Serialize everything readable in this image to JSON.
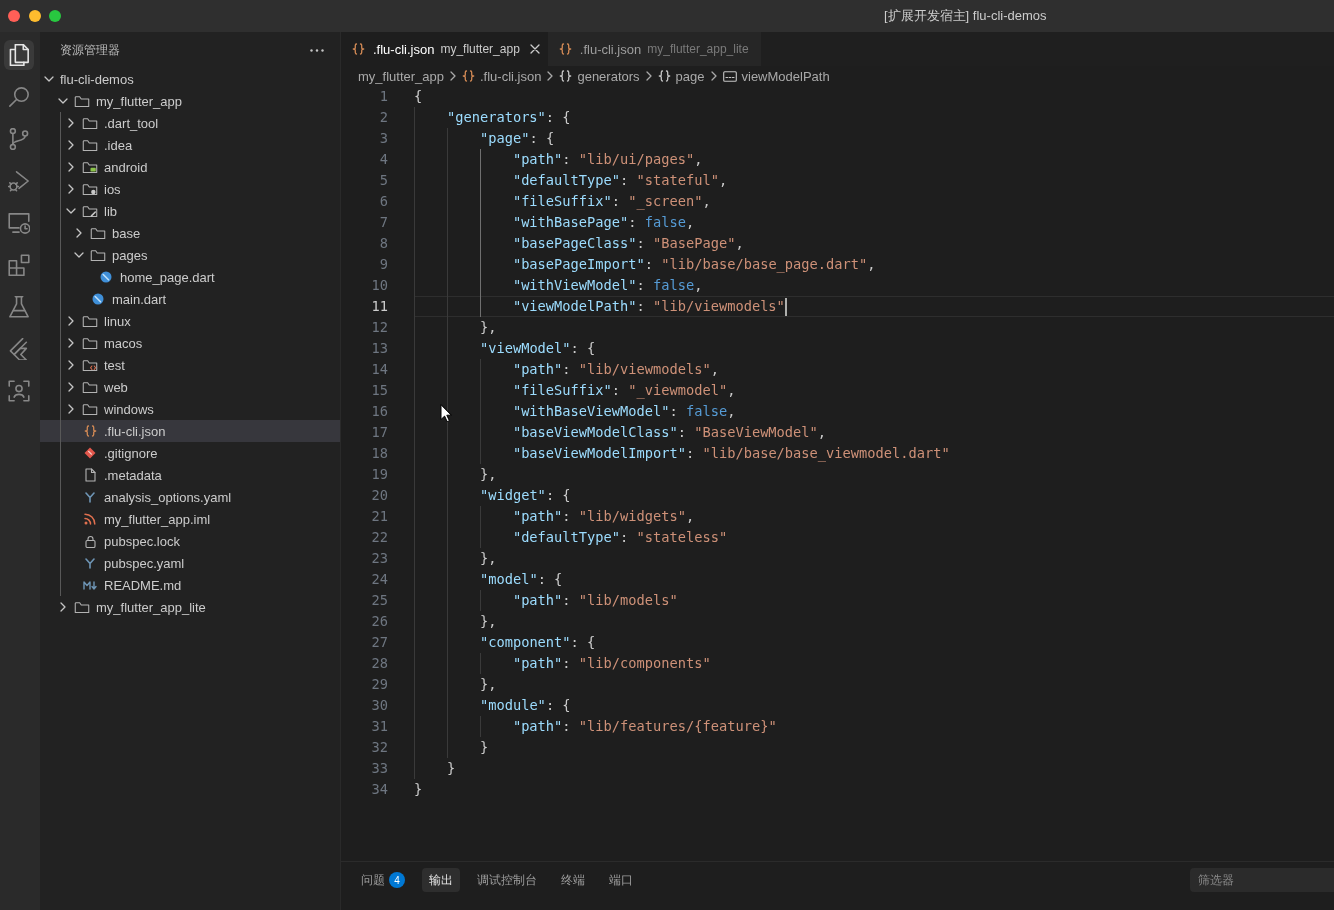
{
  "window": {
    "title": "[扩展开发宿主] flu-cli-demos"
  },
  "activity_bar": {
    "items": [
      {
        "kind": "files",
        "selected": true
      },
      {
        "kind": "search",
        "selected": false
      },
      {
        "kind": "branch",
        "selected": false
      },
      {
        "kind": "debug",
        "selected": false
      },
      {
        "kind": "remote",
        "selected": false
      },
      {
        "kind": "extensions",
        "selected": false
      },
      {
        "kind": "flask",
        "selected": false
      },
      {
        "kind": "chevrons",
        "selected": false
      },
      {
        "kind": "scan",
        "selected": false
      }
    ]
  },
  "explorer": {
    "title": "资源管理器",
    "tree": [
      {
        "label": "flu-cli-demos",
        "kind": "root",
        "expanded": true,
        "selected": false,
        "children": [
          {
            "label": "my_flutter_app",
            "kind": "folder",
            "expanded": true,
            "selected": false,
            "children": [
              {
                "label": ".dart_tool",
                "kind": "folder",
                "expanded": false,
                "selected": false
              },
              {
                "label": ".idea",
                "kind": "folder",
                "expanded": false,
                "selected": false
              },
              {
                "label": "android",
                "kind": "android",
                "expanded": false,
                "selected": false
              },
              {
                "label": "ios",
                "kind": "ios",
                "expanded": false,
                "selected": false
              },
              {
                "label": "lib",
                "kind": "lib",
                "expanded": true,
                "selected": false,
                "children": [
                  {
                    "label": "base",
                    "kind": "folder",
                    "expanded": false,
                    "selected": false
                  },
                  {
                    "label": "pages",
                    "kind": "folder",
                    "expanded": true,
                    "selected": false,
                    "children": [
                      {
                        "label": "home_page.dart",
                        "kind": "dart",
                        "selected": false
                      }
                    ]
                  },
                  {
                    "label": "main.dart",
                    "kind": "dart",
                    "selected": false
                  }
                ]
              },
              {
                "label": "linux",
                "kind": "folder",
                "expanded": false,
                "selected": false
              },
              {
                "label": "macos",
                "kind": "folder",
                "expanded": false,
                "selected": false
              },
              {
                "label": "test",
                "kind": "test",
                "expanded": false,
                "selected": false
              },
              {
                "label": "web",
                "kind": "folder",
                "expanded": false,
                "selected": false
              },
              {
                "label": "windows",
                "kind": "folder",
                "expanded": false,
                "selected": false
              },
              {
                "label": ".flu-cli.json",
                "kind": "json",
                "selected": true
              },
              {
                "label": ".gitignore",
                "kind": "git",
                "selected": false
              },
              {
                "label": ".metadata",
                "kind": "file",
                "selected": false
              },
              {
                "label": "analysis_options.yaml",
                "kind": "yaml",
                "selected": false
              },
              {
                "label": "my_flutter_app.iml",
                "kind": "feed",
                "selected": false
              },
              {
                "label": "pubspec.lock",
                "kind": "lock",
                "selected": false
              },
              {
                "label": "pubspec.yaml",
                "kind": "yaml",
                "selected": false
              },
              {
                "label": "README.md",
                "kind": "markdown",
                "selected": false
              }
            ]
          },
          {
            "label": "my_flutter_app_lite",
            "kind": "folder",
            "expanded": false,
            "selected": false
          }
        ]
      }
    ]
  },
  "editor": {
    "tabs": [
      {
        "filename": ".flu-cli.json",
        "folder": "my_flutter_app",
        "selected": true
      },
      {
        "filename": ".flu-cli.json",
        "folder": "my_flutter_app_lite",
        "selected": false
      }
    ],
    "breadcrumbs": [
      {
        "label": "my_flutter_app",
        "kind": "folder"
      },
      {
        "label": ".flu-cli.json",
        "kind": "json"
      },
      {
        "label": "generators",
        "kind": "object"
      },
      {
        "label": "page",
        "kind": "object"
      },
      {
        "label": "viewModelPath",
        "kind": "string"
      }
    ],
    "lines": [
      {
        "number": "1",
        "text": "{",
        "current": false
      },
      {
        "number": "2",
        "text": "    \"generators\": {",
        "current": false
      },
      {
        "number": "3",
        "text": "        \"page\": {",
        "current": false
      },
      {
        "number": "4",
        "text": "            \"path\": \"lib/ui/pages\",",
        "current": false
      },
      {
        "number": "5",
        "text": "            \"defaultType\": \"stateful\",",
        "current": false
      },
      {
        "number": "6",
        "text": "            \"fileSuffix\": \"_screen\",",
        "current": false
      },
      {
        "number": "7",
        "text": "            \"withBasePage\": false,",
        "current": false
      },
      {
        "number": "8",
        "text": "            \"basePageClass\": \"BasePage\",",
        "current": false
      },
      {
        "number": "9",
        "text": "            \"basePageImport\": \"lib/base/base_page.dart\",",
        "current": false
      },
      {
        "number": "10",
        "text": "            \"withViewModel\": false,",
        "current": false
      },
      {
        "number": "11",
        "text": "            \"viewModelPath\": \"lib/viewmodels\"",
        "current": true
      },
      {
        "number": "12",
        "text": "        },",
        "current": false
      },
      {
        "number": "13",
        "text": "        \"viewModel\": {",
        "current": false
      },
      {
        "number": "14",
        "text": "            \"path\": \"lib/viewmodels\",",
        "current": false
      },
      {
        "number": "15",
        "text": "            \"fileSuffix\": \"_viewmodel\",",
        "current": false
      },
      {
        "number": "16",
        "text": "            \"withBaseViewModel\": false,",
        "current": false
      },
      {
        "number": "17",
        "text": "            \"baseViewModelClass\": \"BaseViewModel\",",
        "current": false
      },
      {
        "number": "18",
        "text": "            \"baseViewModelImport\": \"lib/base/base_viewmodel.dart\"",
        "current": false
      },
      {
        "number": "19",
        "text": "        },",
        "current": false
      },
      {
        "number": "20",
        "text": "        \"widget\": {",
        "current": false
      },
      {
        "number": "21",
        "text": "            \"path\": \"lib/widgets\",",
        "current": false
      },
      {
        "number": "22",
        "text": "            \"defaultType\": \"stateless\"",
        "current": false
      },
      {
        "number": "23",
        "text": "        },",
        "current": false
      },
      {
        "number": "24",
        "text": "        \"model\": {",
        "current": false
      },
      {
        "number": "25",
        "text": "            \"path\": \"lib/models\"",
        "current": false
      },
      {
        "number": "26",
        "text": "        },",
        "current": false
      },
      {
        "number": "27",
        "text": "        \"component\": {",
        "current": false
      },
      {
        "number": "28",
        "text": "            \"path\": \"lib/components\"",
        "current": false
      },
      {
        "number": "29",
        "text": "        },",
        "current": false
      },
      {
        "number": "30",
        "text": "        \"module\": {",
        "current": false
      },
      {
        "number": "31",
        "text": "            \"path\": \"lib/features/{feature}\"",
        "current": false
      },
      {
        "number": "32",
        "text": "        }",
        "current": false
      },
      {
        "number": "33",
        "text": "    }",
        "current": false
      },
      {
        "number": "34",
        "text": "}",
        "current": false
      }
    ]
  },
  "panel": {
    "tabs": [
      {
        "label": "问题",
        "badge": "4",
        "selected": false
      },
      {
        "label": "输出",
        "selected": true
      },
      {
        "label": "调试控制台",
        "selected": false
      },
      {
        "label": "终端",
        "selected": false
      },
      {
        "label": "端口",
        "selected": false
      }
    ],
    "filter": {
      "placeholder": "筛选器"
    }
  }
}
